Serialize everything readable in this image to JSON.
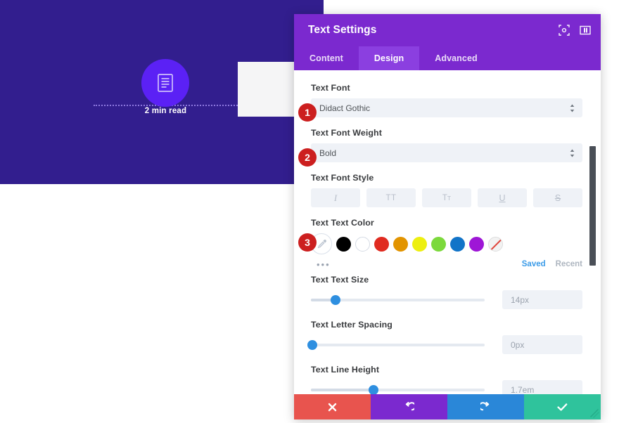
{
  "canvas": {
    "background_color": "#321E8E",
    "blurb": {
      "icon": "document-icon",
      "circle_color": "#5B21F5",
      "read_time": "2 min read"
    }
  },
  "modal": {
    "title": "Text Settings",
    "header_icons": [
      {
        "name": "focus-target-icon"
      },
      {
        "name": "layout-panel-icon"
      }
    ],
    "tabs": [
      {
        "label": "Content",
        "active": false
      },
      {
        "label": "Design",
        "active": true
      },
      {
        "label": "Advanced",
        "active": false
      }
    ],
    "fields": {
      "text_font": {
        "label": "Text Font",
        "value": "Didact Gothic",
        "badge": "1"
      },
      "text_font_weight": {
        "label": "Text Font Weight",
        "value": "Bold",
        "badge": "2"
      },
      "text_font_style": {
        "label": "Text Font Style",
        "buttons": [
          {
            "name": "italic-button",
            "glyph": "I"
          },
          {
            "name": "uppercase-button",
            "glyph": "TT"
          },
          {
            "name": "small-caps-button",
            "glyph": "T"
          },
          {
            "name": "underline-button",
            "glyph": "U"
          },
          {
            "name": "strikethrough-button",
            "glyph": "S"
          }
        ]
      },
      "text_color": {
        "label": "Text Text Color",
        "badge": "3",
        "eyedropper": "eyedropper-icon",
        "swatches": [
          {
            "name": "swatch-black",
            "color": "#000000"
          },
          {
            "name": "swatch-white",
            "color": "#FFFFFF"
          },
          {
            "name": "swatch-red",
            "color": "#E02B20"
          },
          {
            "name": "swatch-orange",
            "color": "#E29400"
          },
          {
            "name": "swatch-yellow",
            "color": "#EDEF10"
          },
          {
            "name": "swatch-green",
            "color": "#7CD93C"
          },
          {
            "name": "swatch-blue",
            "color": "#1274C8"
          },
          {
            "name": "swatch-purple",
            "color": "#9E16D6"
          },
          {
            "name": "swatch-none",
            "color": "transparent"
          }
        ],
        "more_dots": "•••",
        "saved_label": "Saved",
        "recent_label": "Recent"
      },
      "text_size": {
        "label": "Text Text Size",
        "value": "14px",
        "percent": 14
      },
      "letter_spacing": {
        "label": "Text Letter Spacing",
        "value": "0px",
        "percent": 0
      },
      "line_height": {
        "label": "Text Line Height",
        "value": "1.7em",
        "percent": 36
      }
    },
    "actions": [
      {
        "name": "cancel-button",
        "glyph": "✖",
        "color": "#E8544E"
      },
      {
        "name": "undo-button",
        "glyph": "↺",
        "color": "#7B29CF"
      },
      {
        "name": "redo-button",
        "glyph": "↻",
        "color": "#2A87D8"
      },
      {
        "name": "save-button",
        "glyph": "✔",
        "color": "#2FC39C"
      }
    ]
  }
}
